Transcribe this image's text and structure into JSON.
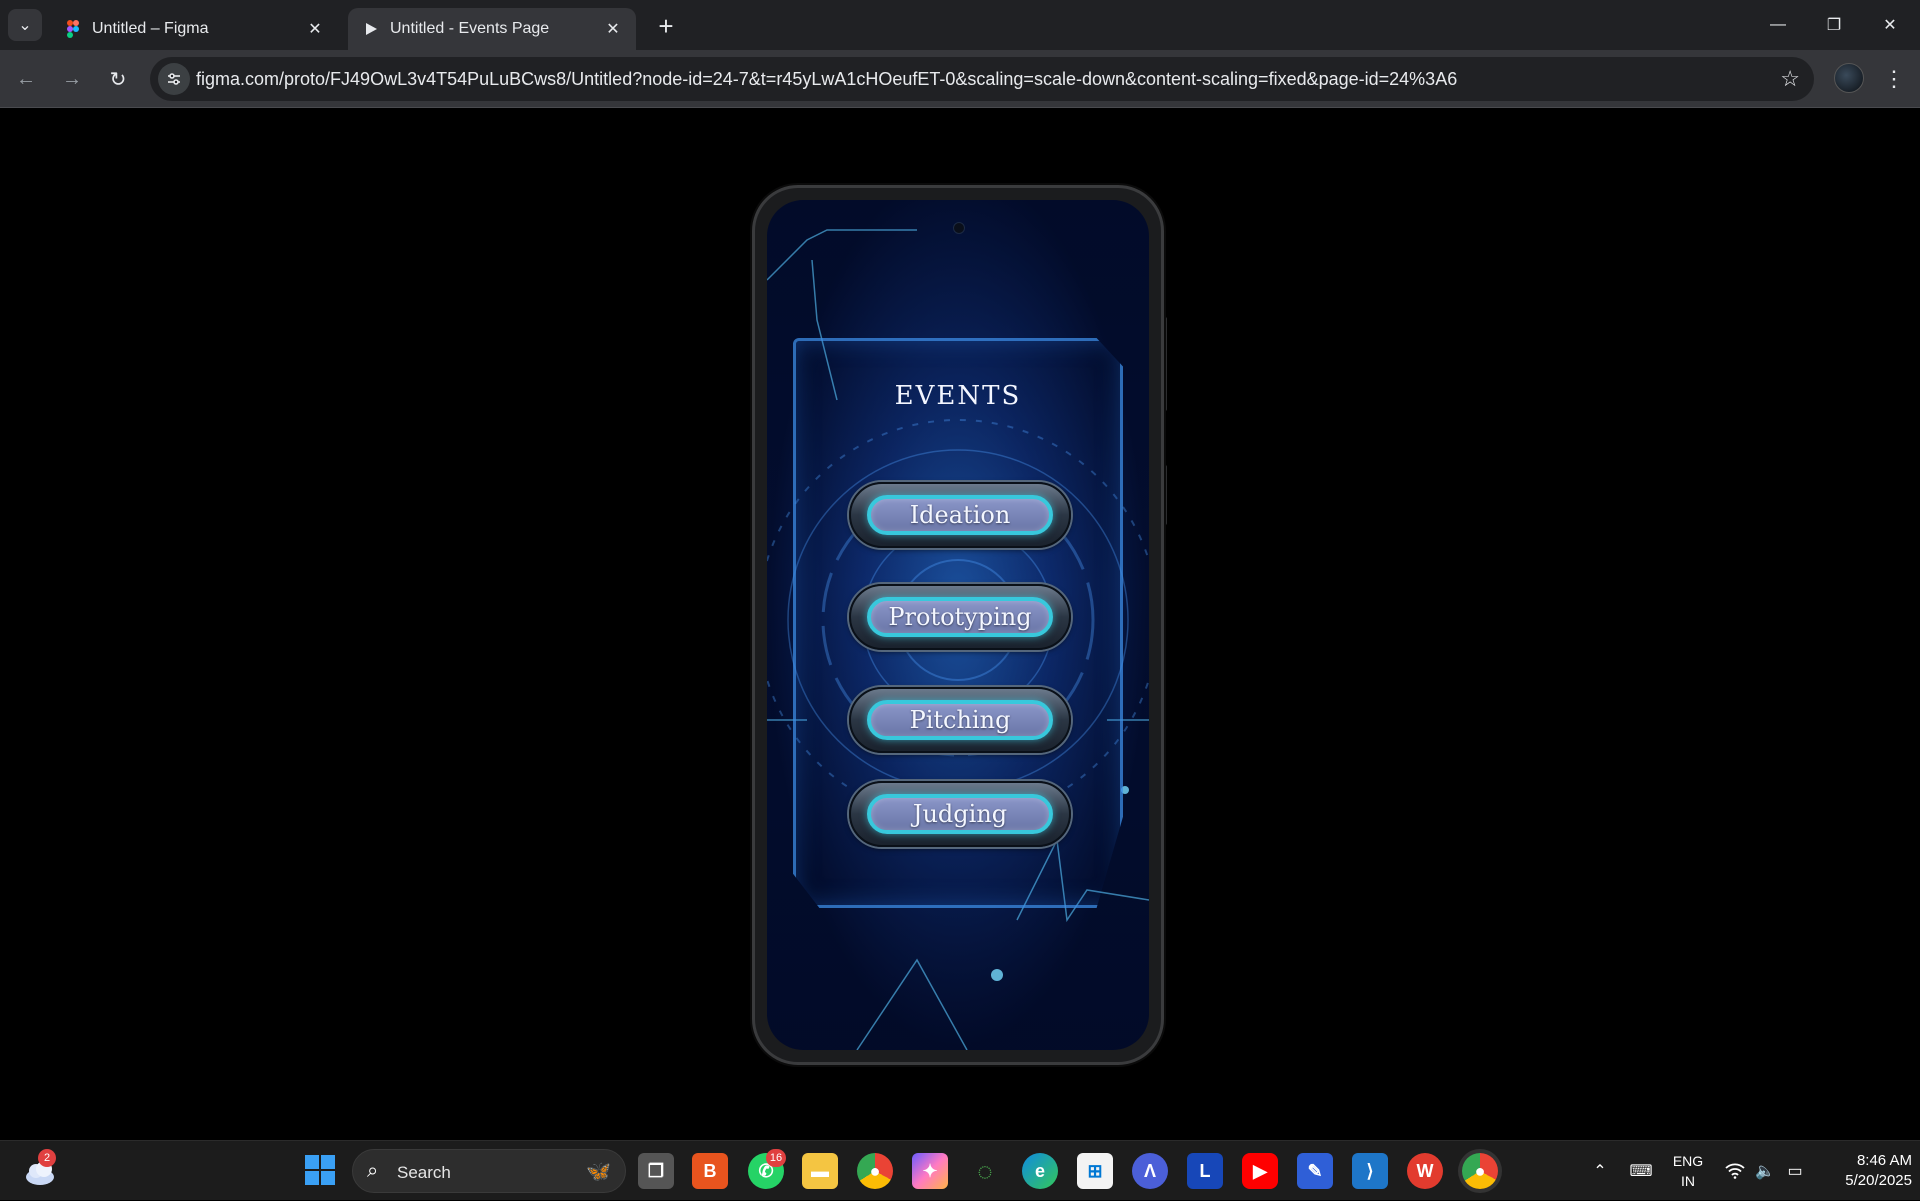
{
  "browser": {
    "tabs": [
      {
        "title": "Untitled – Figma",
        "active": false
      },
      {
        "title": "Untitled - Events Page",
        "active": true
      }
    ],
    "url": "figma.com/proto/FJ49OwL3v4T54PuLuBCws8/Untitled?node-id=24-7&t=r45yLwA1cHOeufET-0&scaling=scale-down&content-scaling=fixed&page-id=24%3A6"
  },
  "prototype": {
    "heading": "EVENTS",
    "events": [
      "Ideation",
      "Prototyping",
      "Pitching",
      "Judging"
    ]
  },
  "taskbar": {
    "weather_badge": "2",
    "search_label": "Search",
    "whatsapp_badge": "16",
    "language": {
      "line1": "ENG",
      "line2": "IN"
    },
    "time": "8:46 AM",
    "date": "5/20/2025"
  },
  "colors": {
    "accent_cyan": "#38c8dc",
    "chrome_dark": "#202124",
    "chrome_tab": "#35363a",
    "screen_blue": "#0a2a66"
  },
  "icons": [
    "tab-list-icon",
    "figma-icon",
    "play-icon",
    "close-icon",
    "plus-icon",
    "minimize-icon",
    "restore-icon",
    "back-icon",
    "forward-icon",
    "reload-icon",
    "site-info-icon",
    "star-icon",
    "kebab-menu-icon",
    "windows-start-icon",
    "search-icon"
  ]
}
